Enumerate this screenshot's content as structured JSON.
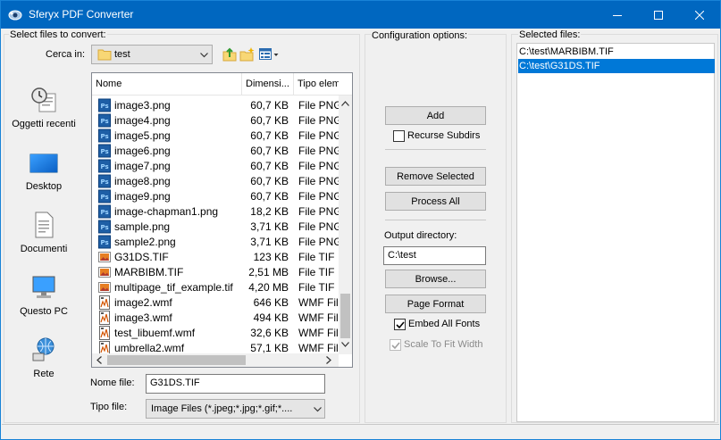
{
  "window": {
    "title": "Sferyx PDF Converter",
    "controls": [
      "minimize",
      "maximize",
      "close"
    ]
  },
  "file_chooser": {
    "section_label": "Select files to convert:",
    "look_in_label": "Cerca in:",
    "look_in_value": "test",
    "places": [
      {
        "label": "Oggetti recenti",
        "icon": "recent-icon"
      },
      {
        "label": "Desktop",
        "icon": "desktop-icon"
      },
      {
        "label": "Documenti",
        "icon": "documents-icon"
      },
      {
        "label": "Questo PC",
        "icon": "computer-icon"
      },
      {
        "label": "Rete",
        "icon": "network-icon"
      }
    ],
    "columns": [
      "Nome",
      "Dimensi...",
      "Tipo elem"
    ],
    "files": [
      {
        "name": "image3.png",
        "size": "60,7 KB",
        "type": "File PNG",
        "icon": "ps"
      },
      {
        "name": "image4.png",
        "size": "60,7 KB",
        "type": "File PNG",
        "icon": "ps"
      },
      {
        "name": "image5.png",
        "size": "60,7 KB",
        "type": "File PNG",
        "icon": "ps"
      },
      {
        "name": "image6.png",
        "size": "60,7 KB",
        "type": "File PNG",
        "icon": "ps"
      },
      {
        "name": "image7.png",
        "size": "60,7 KB",
        "type": "File PNG",
        "icon": "ps"
      },
      {
        "name": "image8.png",
        "size": "60,7 KB",
        "type": "File PNG",
        "icon": "ps"
      },
      {
        "name": "image9.png",
        "size": "60,7 KB",
        "type": "File PNG",
        "icon": "ps"
      },
      {
        "name": "image-chapman1.png",
        "size": "18,2 KB",
        "type": "File PNG",
        "icon": "ps"
      },
      {
        "name": "sample.png",
        "size": "3,71 KB",
        "type": "File PNG",
        "icon": "ps"
      },
      {
        "name": "sample2.png",
        "size": "3,71 KB",
        "type": "File PNG",
        "icon": "ps"
      },
      {
        "name": "G31DS.TIF",
        "size": "123 KB",
        "type": "File TIF",
        "icon": "tif"
      },
      {
        "name": "MARBIBM.TIF",
        "size": "2,51 MB",
        "type": "File TIF",
        "icon": "tif"
      },
      {
        "name": "multipage_tif_example.tif",
        "size": "4,20 MB",
        "type": "File TIF",
        "icon": "tif"
      },
      {
        "name": "image2.wmf",
        "size": "646 KB",
        "type": "WMF Fil",
        "icon": "wmf"
      },
      {
        "name": "image3.wmf",
        "size": "494 KB",
        "type": "WMF Fil",
        "icon": "wmf"
      },
      {
        "name": "test_libuemf.wmf",
        "size": "32,6 KB",
        "type": "WMF Fil",
        "icon": "wmf"
      },
      {
        "name": "umbrella2.wmf",
        "size": "57,1 KB",
        "type": "WMF Fil",
        "icon": "wmf"
      }
    ],
    "file_name_label": "Nome file:",
    "file_name_value": "G31DS.TIF",
    "file_type_label": "Tipo file:",
    "file_type_value": "Image Files (*.jpeg;*.jpg;*.gif;*...."
  },
  "config": {
    "section_label": "Configuration options:",
    "add_label": "Add",
    "recurse_label": "Recurse Subdirs",
    "recurse_checked": false,
    "remove_label": "Remove Selected",
    "process_label": "Process All",
    "output_dir_label": "Output directory:",
    "output_dir_value": "C:\\test",
    "browse_label": "Browse...",
    "page_format_label": "Page Format",
    "embed_fonts_label": "Embed All Fonts",
    "embed_fonts_checked": true,
    "scale_label": "Scale To Fit Width",
    "scale_checked": true
  },
  "selected": {
    "section_label": "Selected files:",
    "items": [
      {
        "path": "C:\\test\\MARBIBM.TIF",
        "selected": false
      },
      {
        "path": "C:\\test\\G31DS.TIF",
        "selected": true
      }
    ]
  },
  "colors": {
    "titlebar": "#0067c0",
    "selection": "#0078d7"
  }
}
